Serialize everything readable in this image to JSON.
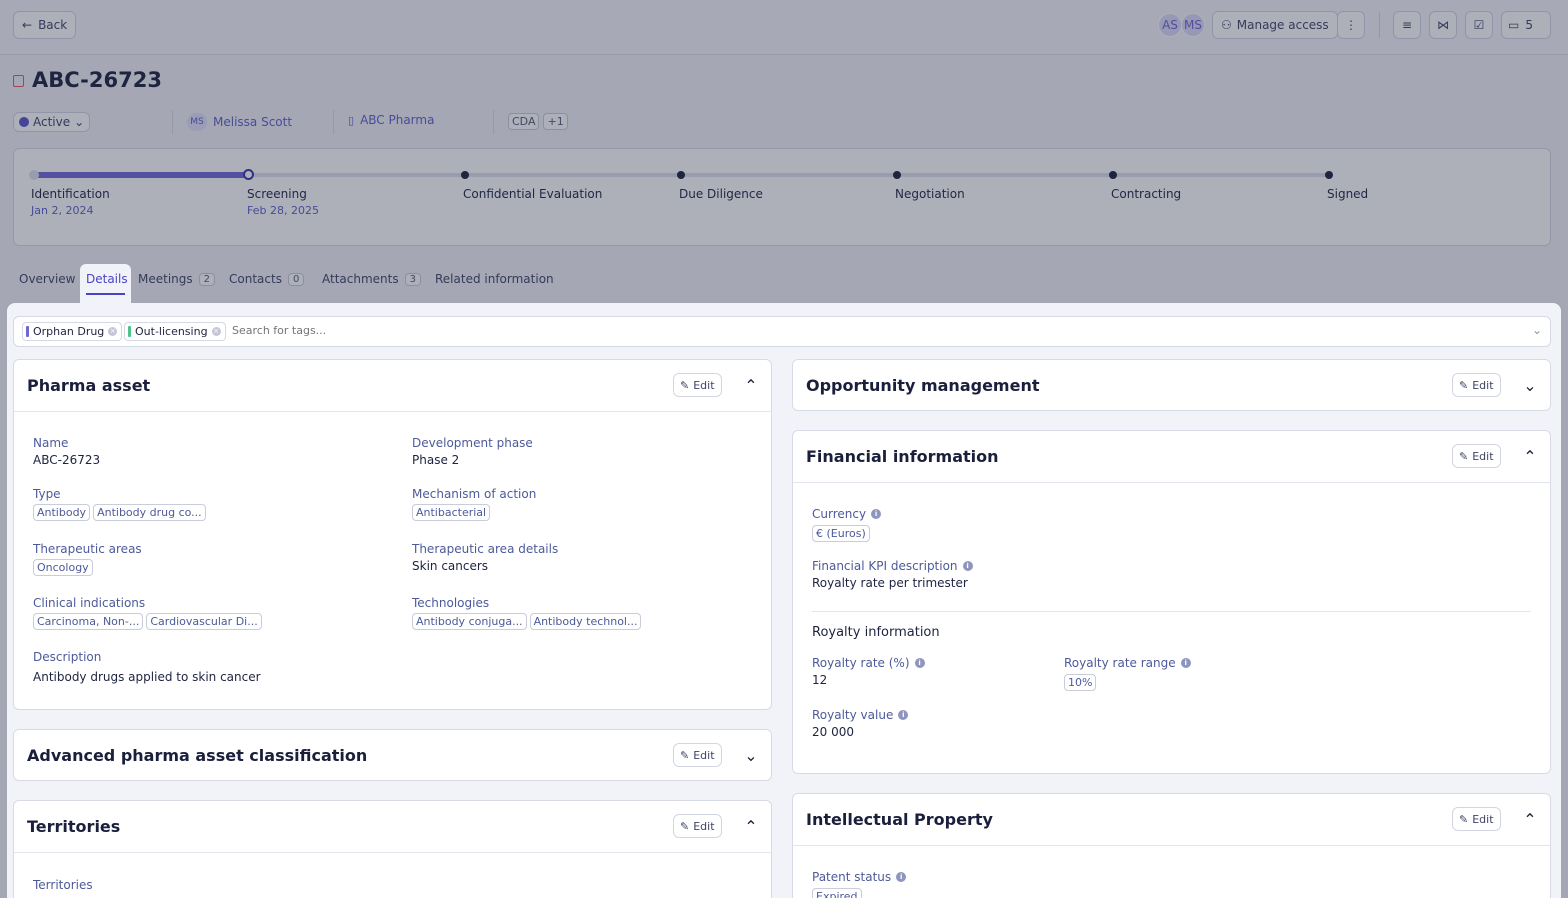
{
  "topbar": {
    "back_label": "Back",
    "avatars": [
      "AS",
      "MS"
    ],
    "manage_access_label": "Manage access",
    "comments_count": "5"
  },
  "deal": {
    "title": "ABC-26723",
    "status": "Active",
    "owner_initials": "MS",
    "owner": "Melissa Scott",
    "company": "ABC Pharma",
    "agreement": "CDA",
    "agreement_more": "+1"
  },
  "stages": [
    {
      "label": "Identification",
      "date": "Jan 2, 2024"
    },
    {
      "label": "Screening",
      "date": "Feb 28, 2025"
    },
    {
      "label": "Confidential Evaluation",
      "date": ""
    },
    {
      "label": "Due Diligence",
      "date": ""
    },
    {
      "label": "Negotiation",
      "date": ""
    },
    {
      "label": "Contracting",
      "date": ""
    },
    {
      "label": "Signed",
      "date": ""
    }
  ],
  "tabs": [
    {
      "label": "Overview",
      "count": ""
    },
    {
      "label": "Details",
      "count": ""
    },
    {
      "label": "Meetings",
      "count": "2"
    },
    {
      "label": "Contacts",
      "count": "0"
    },
    {
      "label": "Attachments",
      "count": "3"
    },
    {
      "label": "Related information",
      "count": ""
    }
  ],
  "tags": {
    "items": [
      {
        "label": "Orphan Drug",
        "color": "#6e67d9"
      },
      {
        "label": "Out-licensing",
        "color": "#4fc48a"
      }
    ],
    "placeholder": "Search for tags..."
  },
  "edit_label": "Edit",
  "pharma_asset": {
    "title": "Pharma asset",
    "name_label": "Name",
    "name": "ABC-26723",
    "phase_label": "Development phase",
    "phase": "Phase 2",
    "type_label": "Type",
    "types": [
      "Antibody",
      "Antibody drug co..."
    ],
    "moa_label": "Mechanism of action",
    "moa": [
      "Antibacterial"
    ],
    "ta_label": "Therapeutic areas",
    "ta": [
      "Oncology"
    ],
    "ta_details_label": "Therapeutic area details",
    "ta_details": "Skin cancers",
    "clinical_label": "Clinical indications",
    "clinical": [
      "Carcinoma, Non-...",
      "Cardiovascular Di..."
    ],
    "tech_label": "Technologies",
    "tech": [
      "Antibody conjuga...",
      "Antibody technol..."
    ],
    "desc_label": "Description",
    "desc": "Antibody drugs applied to skin cancer"
  },
  "advanced": {
    "title": "Advanced pharma asset classification"
  },
  "territories": {
    "title": "Territories",
    "field_label": "Territories"
  },
  "opportunity": {
    "title": "Opportunity management"
  },
  "financial": {
    "title": "Financial information",
    "currency_label": "Currency",
    "currency": "€ (Euros)",
    "kpi_label": "Financial KPI description",
    "kpi": "Royalty rate per trimester",
    "royalty_heading": "Royalty information",
    "rate_label": "Royalty rate (%)",
    "rate": "12",
    "range_label": "Royalty rate range",
    "range": "10%",
    "value_label": "Royalty value",
    "value": "20 000"
  },
  "ip": {
    "title": "Intellectual Property",
    "patent_label": "Patent status",
    "patent": "Expired"
  }
}
